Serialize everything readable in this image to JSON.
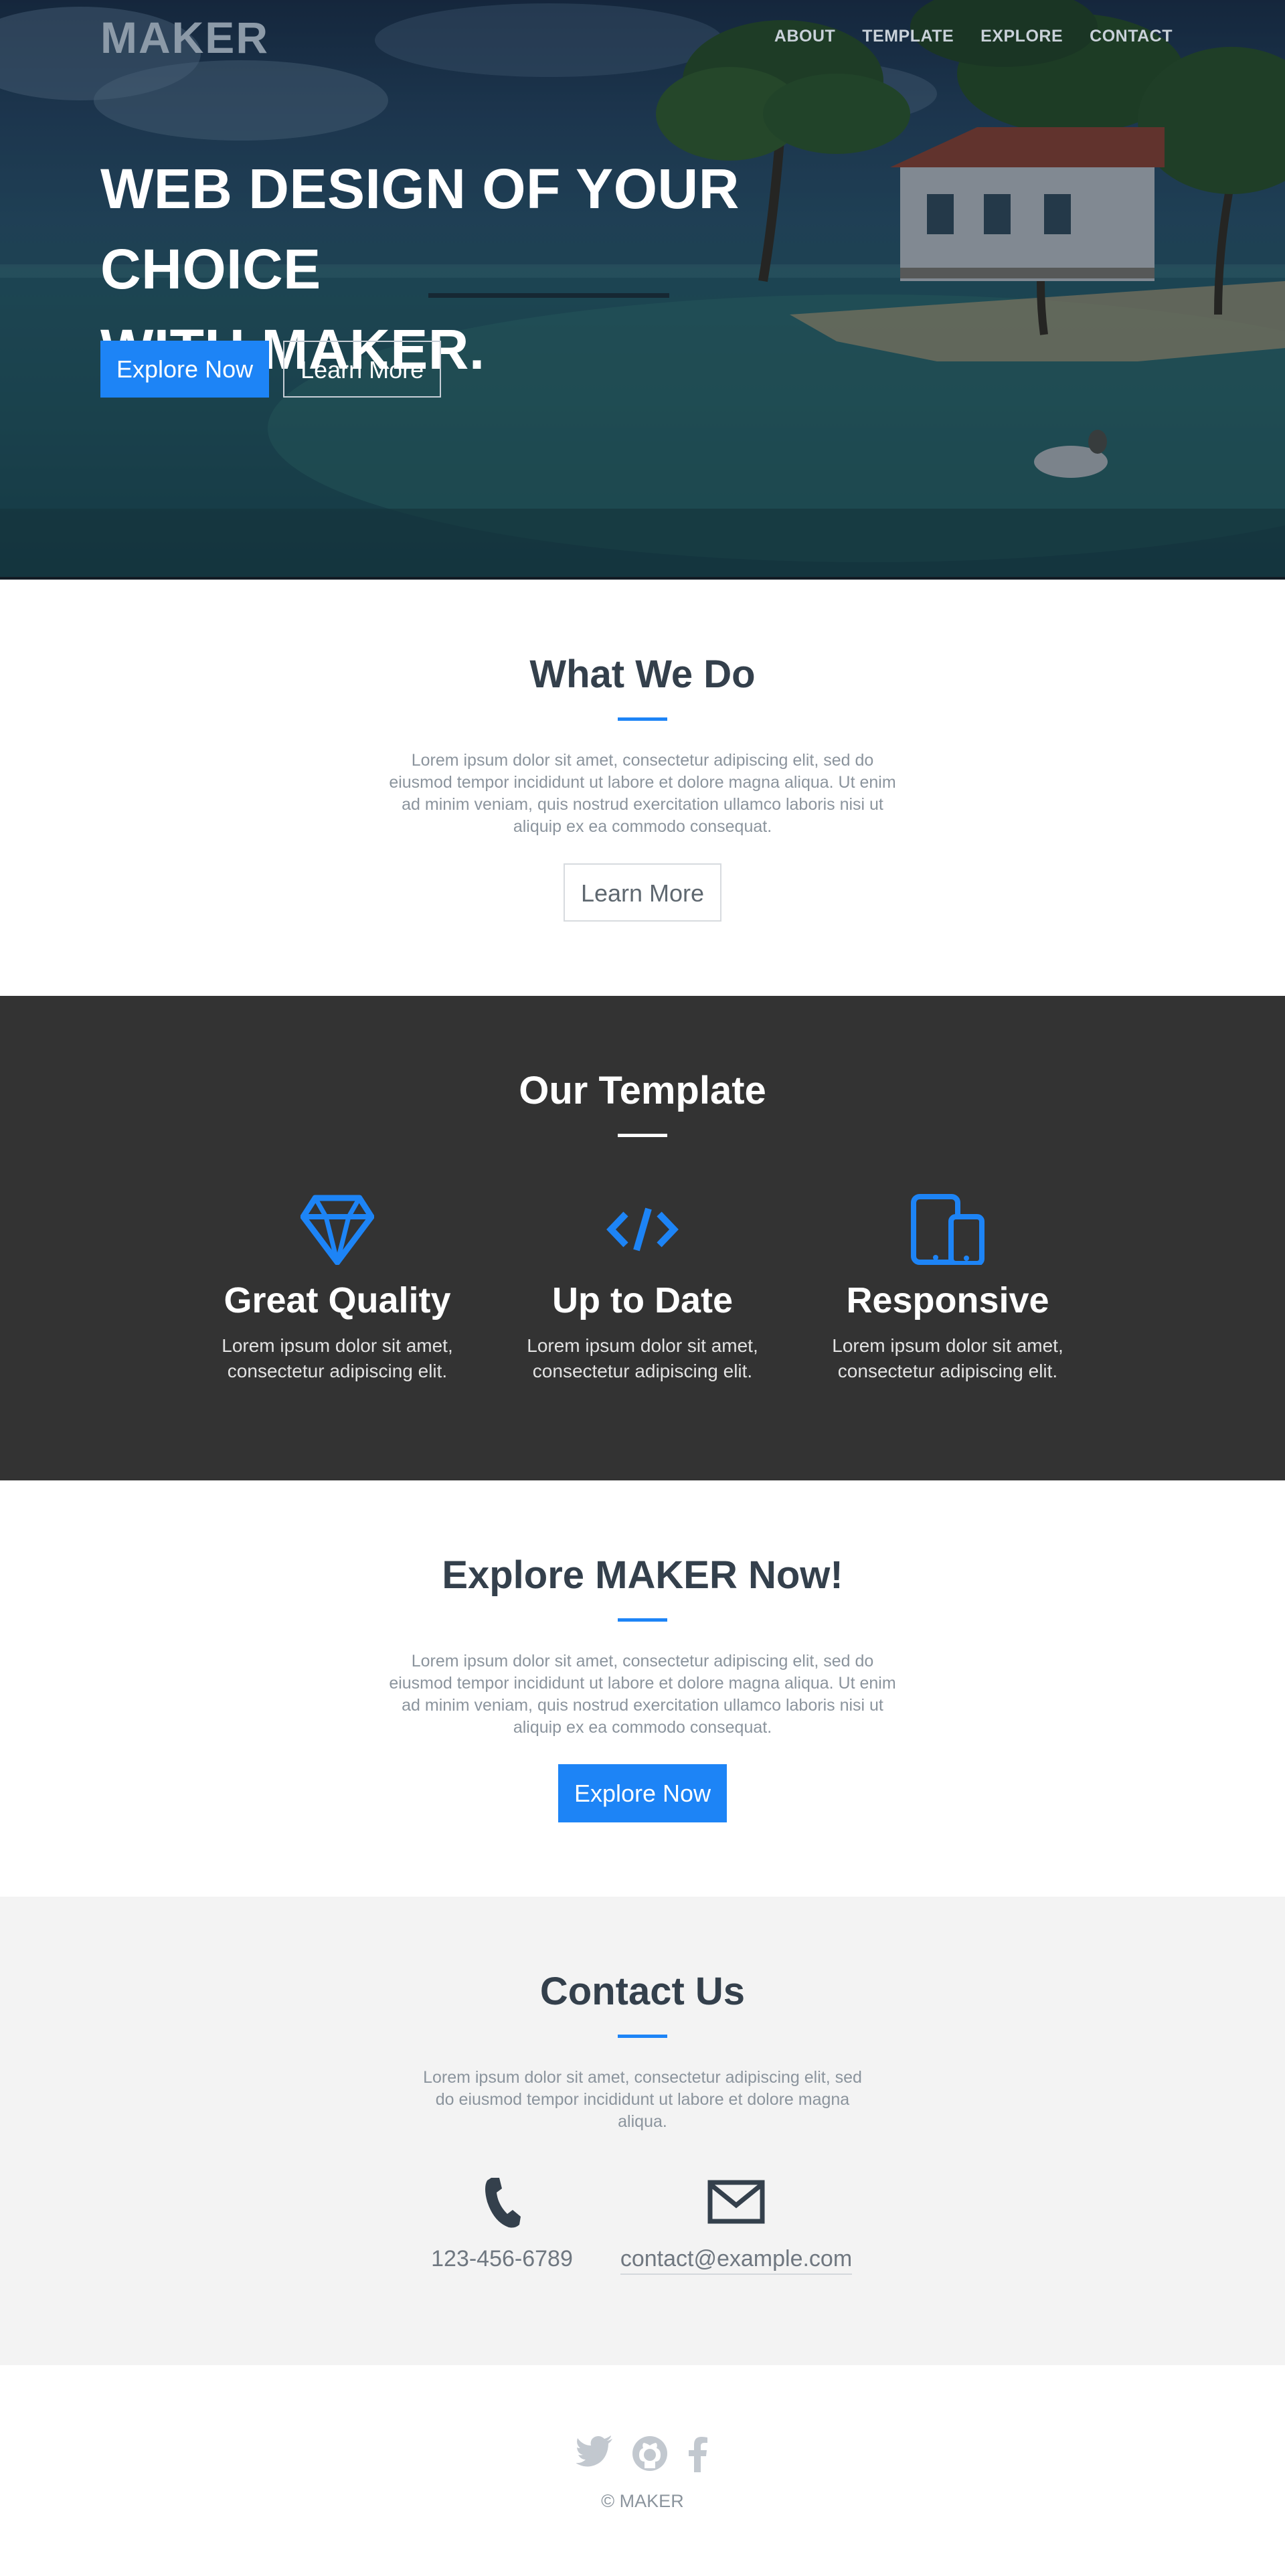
{
  "brand": {
    "logo": "MAKER",
    "accent_color": "#1d84f6"
  },
  "nav": {
    "items": [
      {
        "label": "ABOUT"
      },
      {
        "label": "TEMPLATE"
      },
      {
        "label": "EXPLORE"
      },
      {
        "label": "CONTACT"
      }
    ]
  },
  "hero": {
    "title_line1": "WEB DESIGN OF YOUR CHOICE",
    "title_line2": "WITH MAKER.",
    "primary_button": "Explore Now",
    "secondary_button": "Learn More"
  },
  "what_we_do": {
    "title": "What We Do",
    "text": "Lorem ipsum dolor sit amet, consectetur adipiscing elit, sed do eiusmod tempor incididunt ut labore et dolore magna aliqua. Ut enim ad minim veniam, quis nostrud exercitation ullamco laboris nisi ut aliquip ex ea commodo consequat.",
    "button": "Learn More"
  },
  "template": {
    "title": "Our Template",
    "features": [
      {
        "icon": "diamond-icon",
        "title": "Great Quality",
        "text_line1": "Lorem ipsum dolor sit amet,",
        "text_line2": "consectetur adipiscing elit."
      },
      {
        "icon": "code-icon",
        "title": "Up to Date",
        "text_line1": "Lorem ipsum dolor sit amet,",
        "text_line2": "consectetur adipiscing elit."
      },
      {
        "icon": "devices-icon",
        "title": "Responsive",
        "text_line1": "Lorem ipsum dolor sit amet,",
        "text_line2": "consectetur adipiscing elit."
      }
    ]
  },
  "explore": {
    "title": "Explore MAKER Now!",
    "text": "Lorem ipsum dolor sit amet, consectetur adipiscing elit, sed do eiusmod tempor incididunt ut labore et dolore magna aliqua. Ut enim ad minim veniam, quis nostrud exercitation ullamco laboris nisi ut aliquip ex ea commodo consequat.",
    "button": "Explore Now"
  },
  "contact": {
    "title": "Contact Us",
    "text": "Lorem ipsum dolor sit amet, consectetur adipiscing elit, sed do eiusmod tempor incididunt ut labore et dolore magna aliqua.",
    "phone": "123-456-6789",
    "email": "contact@example.com"
  },
  "footer": {
    "social": [
      {
        "icon": "twitter-icon"
      },
      {
        "icon": "github-icon"
      },
      {
        "icon": "facebook-icon"
      }
    ],
    "copyright": "© MAKER"
  }
}
